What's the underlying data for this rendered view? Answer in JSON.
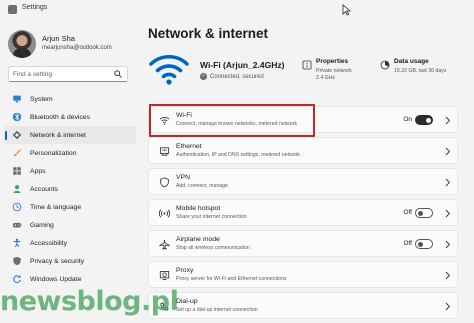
{
  "window": {
    "title": "Settings"
  },
  "user": {
    "name": "Arjun Sha",
    "email": "mearjunsha@outlook.com"
  },
  "search": {
    "placeholder": "Find a setting",
    "icon": "search-icon"
  },
  "sidebar": {
    "items": [
      {
        "label": "System",
        "icon": "monitor-icon",
        "active": false,
        "color": "#2f7bd8"
      },
      {
        "label": "Bluetooth & devices",
        "icon": "bluetooth-icon",
        "active": false,
        "color": "#3a7bd5"
      },
      {
        "label": "Network & internet",
        "icon": "network-diamond-icon",
        "active": true,
        "color": "#4a5b6d"
      },
      {
        "label": "Personalization",
        "icon": "brush-icon",
        "active": false,
        "color": "#e2852f"
      },
      {
        "label": "Apps",
        "icon": "apps-grid-icon",
        "active": false,
        "color": "#5f6b79"
      },
      {
        "label": "Accounts",
        "icon": "person-icon",
        "active": false,
        "color": "#2ea36b"
      },
      {
        "label": "Time & language",
        "icon": "globe-clock-icon",
        "active": false,
        "color": "#2f7bd8"
      },
      {
        "label": "Gaming",
        "icon": "gamepad-icon",
        "active": false,
        "color": "#6a6a6a"
      },
      {
        "label": "Accessibility",
        "icon": "accessibility-icon",
        "active": false,
        "color": "#2f6fc8"
      },
      {
        "label": "Privacy & security",
        "icon": "shield-icon",
        "active": false,
        "color": "#6a6f77"
      },
      {
        "label": "Windows Update",
        "icon": "update-icon",
        "active": false,
        "color": "#2f7bd8"
      }
    ]
  },
  "main": {
    "title": "Network & internet",
    "connection": {
      "name": "Wi-Fi (Arjun_2.4GHz)",
      "status": "Connected, secured"
    },
    "properties": {
      "title": "Properties",
      "line1": "Private network",
      "line2": "2.4 GHz"
    },
    "data_usage": {
      "title": "Data usage",
      "line1": "15.22 GB, last 30 days"
    },
    "rows": [
      {
        "title": "Wi-Fi",
        "subtitle": "Connect, manage known networks, metered network",
        "icon": "wifi-icon",
        "toggle": "On",
        "toggle_on": true
      },
      {
        "title": "Ethernet",
        "subtitle": "Authentication, IP and DNS settings, metered network",
        "icon": "ethernet-icon"
      },
      {
        "title": "VPN",
        "subtitle": "Add, connect, manage",
        "icon": "vpn-shield-icon"
      },
      {
        "title": "Mobile hotspot",
        "subtitle": "Share your internet connection",
        "icon": "hotspot-icon",
        "toggle": "Off",
        "toggle_on": false
      },
      {
        "title": "Airplane mode",
        "subtitle": "Stop all wireless communication",
        "icon": "airplane-icon",
        "toggle": "Off",
        "toggle_on": false
      },
      {
        "title": "Proxy",
        "subtitle": "Proxy server for Wi-Fi and Ethernet connections",
        "icon": "proxy-globe-icon"
      },
      {
        "title": "Dial-up",
        "subtitle": "Set up a dial-up internet connection",
        "icon": "dialup-icon"
      }
    ]
  },
  "watermark": "newsblog.pl",
  "colors": {
    "accent": "#0067c0",
    "highlight": "#c4262e",
    "watermark": "#48a35c"
  }
}
